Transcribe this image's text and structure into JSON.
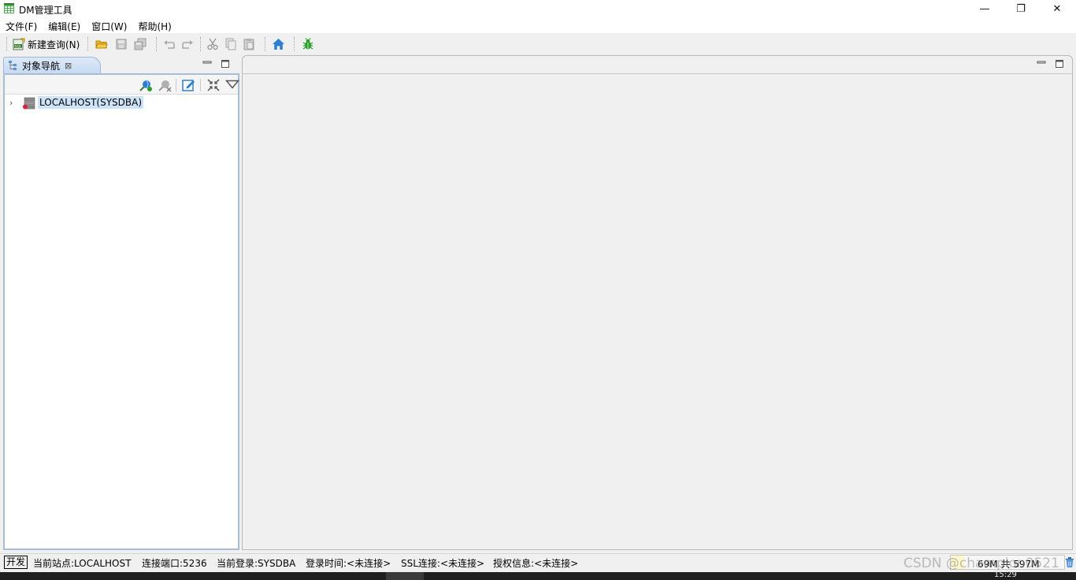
{
  "window": {
    "title": "DM管理工具",
    "minimize_glyph": "—",
    "restore_glyph": "❐",
    "close_glyph": "✕"
  },
  "menubar": {
    "items": [
      "文件(F)",
      "编辑(E)",
      "窗口(W)",
      "帮助(H)"
    ]
  },
  "toolbar": {
    "new_query_label": "新建查询(N)",
    "icons": [
      "new-query-sql-icon",
      "open-folder-icon",
      "save-icon",
      "save-all-icon",
      "undo-icon",
      "redo-icon",
      "cut-icon",
      "copy-icon",
      "paste-icon",
      "home-icon",
      "debug-bug-icon"
    ]
  },
  "object_navigator": {
    "tab_label": "对象导航",
    "tab_close": "⊠",
    "action_icons": [
      "new-connection-icon",
      "disconnect-icon",
      "edit-icon",
      "collapse-all-icon",
      "view-menu-icon"
    ],
    "tree": [
      {
        "label": "LOCALHOST(SYSDBA)",
        "expander": "›",
        "icon": "database-server-icon"
      }
    ]
  },
  "statusbar": {
    "mode": "开发",
    "site": "当前站点:LOCALHOST",
    "port": "连接端口:5236",
    "login": "当前登录:SYSDBA",
    "login_time": "登录时间:<未连接>",
    "ssl": "SSL连接:<未连接>",
    "license": "授权信息:<未连接>",
    "memory": "69M 共 597M",
    "memory_fraction": 0.12,
    "watermark": "CSDN @champion0521"
  },
  "taskbar": {
    "clock": "15:29"
  },
  "colors": {
    "accent_blue": "#2f7fd0",
    "tab_background": "#c7dbf3",
    "selection": "#cde3f8",
    "bug_green": "#2aa02a"
  }
}
